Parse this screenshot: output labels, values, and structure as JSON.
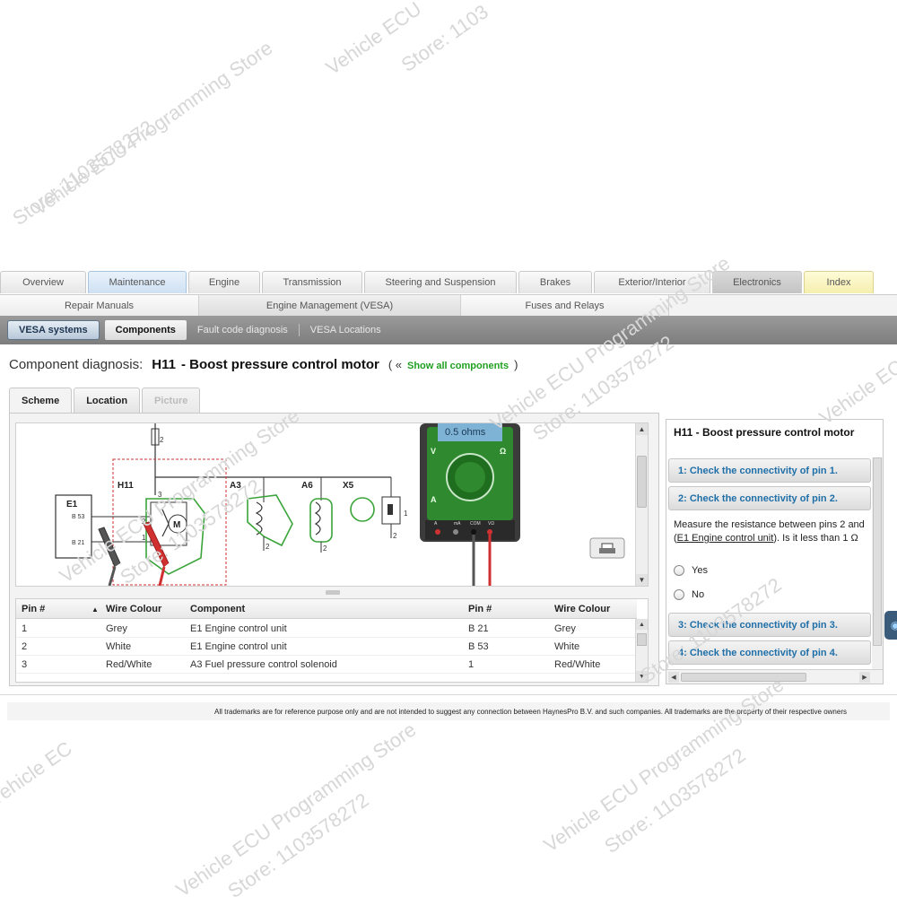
{
  "watermarks": [
    "Vehicle ECU Programming Store",
    "Store: 1103578272",
    "Vehicle ECU",
    "Store: 1103",
    "Vehicle ECU Programming Store",
    "Store: 1103578272",
    "Vehicle ECU Programming Store",
    "Store: 1103578272",
    "Vehicle ECU",
    "Store: 1103578272",
    "Vehicle ECU Programming Store",
    "Store: 1103578272",
    "Vehicle ECU Programming Store",
    "Store: 1103578272",
    "Vehicle EC"
  ],
  "top_tabs": [
    {
      "label": "Overview"
    },
    {
      "label": "Maintenance"
    },
    {
      "label": "Engine"
    },
    {
      "label": "Transmission"
    },
    {
      "label": "Steering and Suspension"
    },
    {
      "label": "Brakes"
    },
    {
      "label": "Exterior/Interior"
    },
    {
      "label": "Electronics"
    },
    {
      "label": "Index"
    }
  ],
  "sub_tabs": [
    {
      "label": "Repair Manuals"
    },
    {
      "label": "Engine Management (VESA)"
    },
    {
      "label": "Fuses and Relays"
    }
  ],
  "toolbar": {
    "systems_button": "VESA systems",
    "components": "Components",
    "fault_code": "Fault code diagnosis",
    "locations": "VESA Locations"
  },
  "page": {
    "label": "Component diagnosis:",
    "code": "H11",
    "name": "- Boost pressure control motor",
    "open_paren": "( «",
    "show_all": "Show all components",
    "close_paren": ")"
  },
  "view_tabs": {
    "scheme": "Scheme",
    "location": "Location",
    "picture": "Picture"
  },
  "diagram": {
    "e1": "E1",
    "b53": "B 53",
    "b21": "B 21",
    "h11": "H11",
    "a3": "A3",
    "a6": "A6",
    "x5": "X5",
    "n1": "1",
    "n2": "2",
    "n3": "3",
    "motor": "M",
    "meter_reading": "0.5 ohms",
    "meter_v": "V",
    "meter_ohm": "Ω",
    "meter_a": "A",
    "meter_port1": "A",
    "meter_port2": "mA",
    "meter_port3": "COM",
    "meter_port4": "VΩ"
  },
  "table": {
    "headers": [
      "Pin #",
      "Wire Colour",
      "Component",
      "Pin #",
      "Wire Colour"
    ],
    "rows": [
      [
        "1",
        "Grey",
        "E1 Engine control unit",
        "B 21",
        "Grey"
      ],
      [
        "2",
        "White",
        "E1 Engine control unit",
        "B 53",
        "White"
      ],
      [
        "3",
        "Red/White",
        "A3 Fuel pressure control solenoid",
        "1",
        "Red/White"
      ],
      [
        "",
        "",
        "",
        "",
        ""
      ]
    ]
  },
  "side": {
    "title": "H11 - Boost pressure control motor",
    "step1": "1: Check the connectivity of pin 1.",
    "step2": "2: Check the connectivity of pin 2.",
    "body_line1": "Measure the resistance between pins 2 and",
    "body_line2_pre": "(",
    "body_link": "E1 Engine control unit",
    "body_line2_post": "). Is it less than 1 Ω",
    "yes": "Yes",
    "no": "No",
    "step3": "3: Check the connectivity of pin 3.",
    "step4": "4: Check the connectivity of pin 4."
  },
  "footer": {
    "text": "All trademarks are for reference purpose only and are not intended to suggest any connection between HaynesPro B.V. and such companies. All trademarks are the property of their respective owners"
  },
  "colors": {
    "diagram_green": "#3aa43a",
    "diagram_red": "#d03030",
    "link_green": "#20a020",
    "step_blue": "#1f6fa8"
  }
}
